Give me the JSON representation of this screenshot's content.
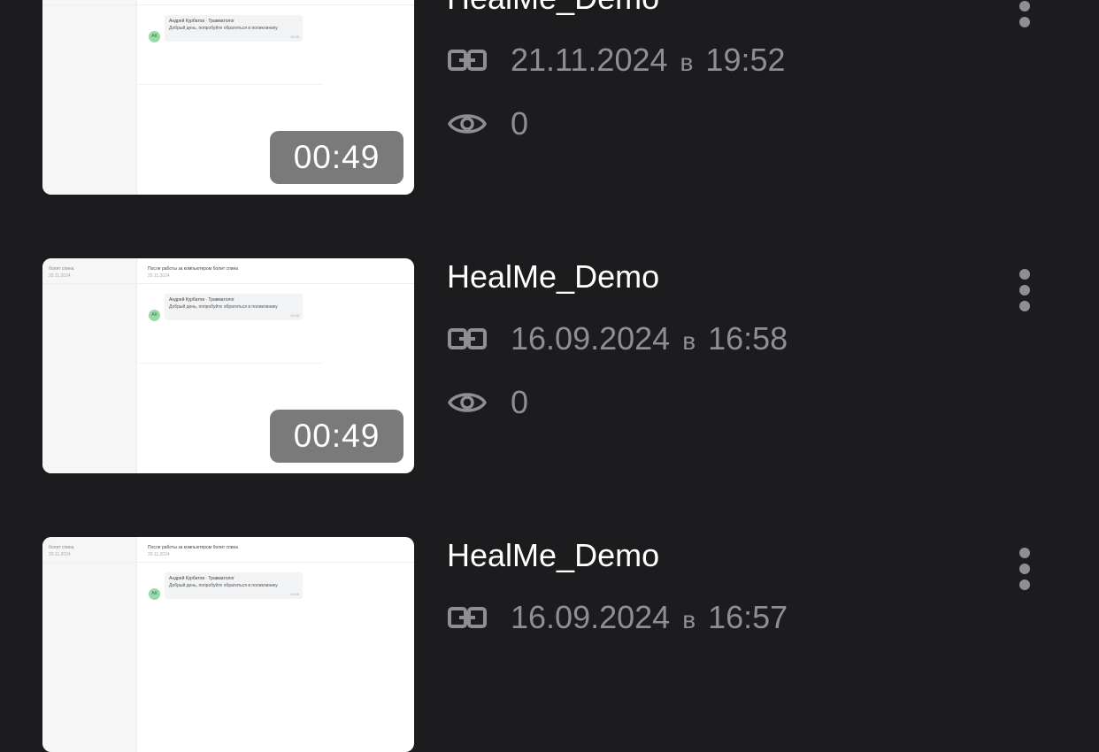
{
  "recordings": [
    {
      "title": "HealMe_Demo",
      "date": "21.11.2024",
      "sep": "в",
      "time": "19:52",
      "views": "0",
      "duration": "00:49",
      "thumb": {
        "sidebar_title": "",
        "sidebar_date": "",
        "header_title": "",
        "header_date": "",
        "avatar": "АК",
        "bubble_name": "Андрей Курбатов · Травматолог",
        "bubble_text": "Добрый день, попробуйте обратиться в поликлинику",
        "bubble_time": "10:55"
      }
    },
    {
      "title": "HealMe_Demo",
      "date": "16.09.2024",
      "sep": "в",
      "time": "16:58",
      "views": "0",
      "duration": "00:49",
      "thumb": {
        "sidebar_title": "болит спина",
        "sidebar_date": "20.11.2024",
        "header_title": "После работы за компьютером болит спина",
        "header_date": "20.11.2024",
        "avatar": "АК",
        "bubble_name": "Андрей Курбатов · Травматолог",
        "bubble_text": "Добрый день, попробуйте обратиться в поликлинику",
        "bubble_time": "10:55"
      }
    },
    {
      "title": "HealMe_Demo",
      "date": "16.09.2024",
      "sep": "в",
      "time": "16:57",
      "views": "",
      "duration": "",
      "thumb": {
        "sidebar_title": "болит спина",
        "sidebar_date": "20.11.2024",
        "header_title": "После работы за компьютером болит спина",
        "header_date": "20.11.2024",
        "avatar": "АК",
        "bubble_name": "Андрей Курбатов · Травматолог",
        "bubble_text": "Добрый день, попробуйте обратиться в поликлинику",
        "bubble_time": "10:55"
      }
    }
  ],
  "icons": {
    "link": "link-icon",
    "views": "eye-icon",
    "more": "more-vertical-icon"
  },
  "colors": {
    "background": "#1c1c1e",
    "muted": "#8e8e93",
    "title": "#ffffff",
    "badge": "#7a7a7a"
  }
}
